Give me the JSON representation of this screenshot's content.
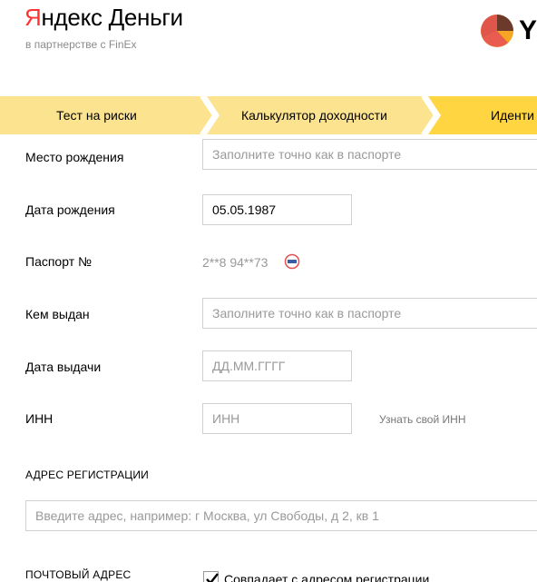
{
  "header": {
    "logo_ya": "Я",
    "logo_rest": "ндекс Деньги",
    "partner_text": "в партнерстве с FinEx",
    "brand_letter": "Y"
  },
  "steps": [
    {
      "label": "Тест на риски"
    },
    {
      "label": "Калькулятор доходности"
    },
    {
      "label": "Иденти"
    }
  ],
  "form": {
    "birthplace": {
      "label": "Место рождения",
      "placeholder": "Заполните точно как в паспорте"
    },
    "birthdate": {
      "label": "Дата рождения",
      "value": "05.05.1987"
    },
    "passport": {
      "label": "Паспорт №",
      "value": "2**8 94**73"
    },
    "issued_by": {
      "label": "Кем выдан",
      "placeholder": "Заполните точно как в паспорте"
    },
    "issue_date": {
      "label": "Дата выдачи",
      "placeholder": "ДД.ММ.ГГГГ"
    },
    "inn": {
      "label": "ИНН",
      "placeholder": "ИНН",
      "hint": "Узнать свой ИНН"
    },
    "registration": {
      "title": "АДРЕС РЕГИСТРАЦИИ",
      "placeholder": "Введите адрес, например: г Москва, ул Свободы, д 2, кв 1"
    },
    "postal": {
      "title": "ПОЧТОВЫЙ АДРЕС",
      "checkbox_label": "Совпадает с адресом регистрации",
      "checked": true
    }
  },
  "colors": {
    "step_light": "#fbe38f",
    "step_active": "#ffd542",
    "accent_red": "#ff3333"
  }
}
